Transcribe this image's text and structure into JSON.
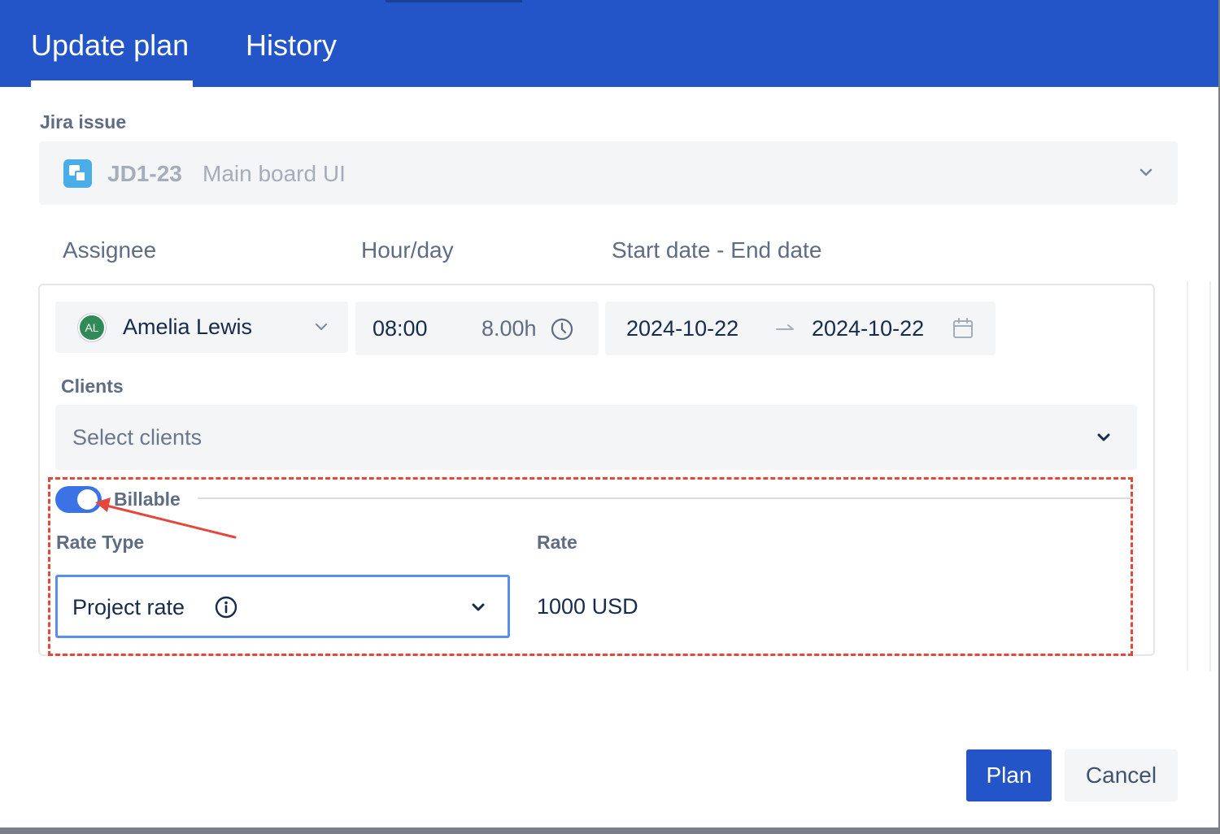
{
  "header": {
    "tabs": [
      {
        "label": "Update plan",
        "active": true
      },
      {
        "label": "History",
        "active": false
      }
    ],
    "color": "#2354c8"
  },
  "jira_issue": {
    "label": "Jira issue",
    "key": "JD1-23",
    "summary": "Main board UI",
    "icon": "subtask-icon"
  },
  "columns": {
    "assignee": "Assignee",
    "hours": "Hour/day",
    "dates": "Start date - End date"
  },
  "row": {
    "assignee": {
      "initials": "AL",
      "name": "Amelia Lewis",
      "avatar_color": "#2f8a57"
    },
    "hours": {
      "time": "08:00",
      "total": "8.00h"
    },
    "dates": {
      "start": "2024-10-22",
      "end": "2024-10-22"
    }
  },
  "clients": {
    "label": "Clients",
    "placeholder": "Select clients"
  },
  "billing": {
    "billable_label": "Billable",
    "billable_on": true,
    "rate_type_label": "Rate Type",
    "rate_type_value": "Project rate",
    "rate_label": "Rate",
    "rate_value": "1000 USD",
    "highlight_color": "#e2483c"
  },
  "footer": {
    "plan_label": "Plan",
    "cancel_label": "Cancel"
  }
}
